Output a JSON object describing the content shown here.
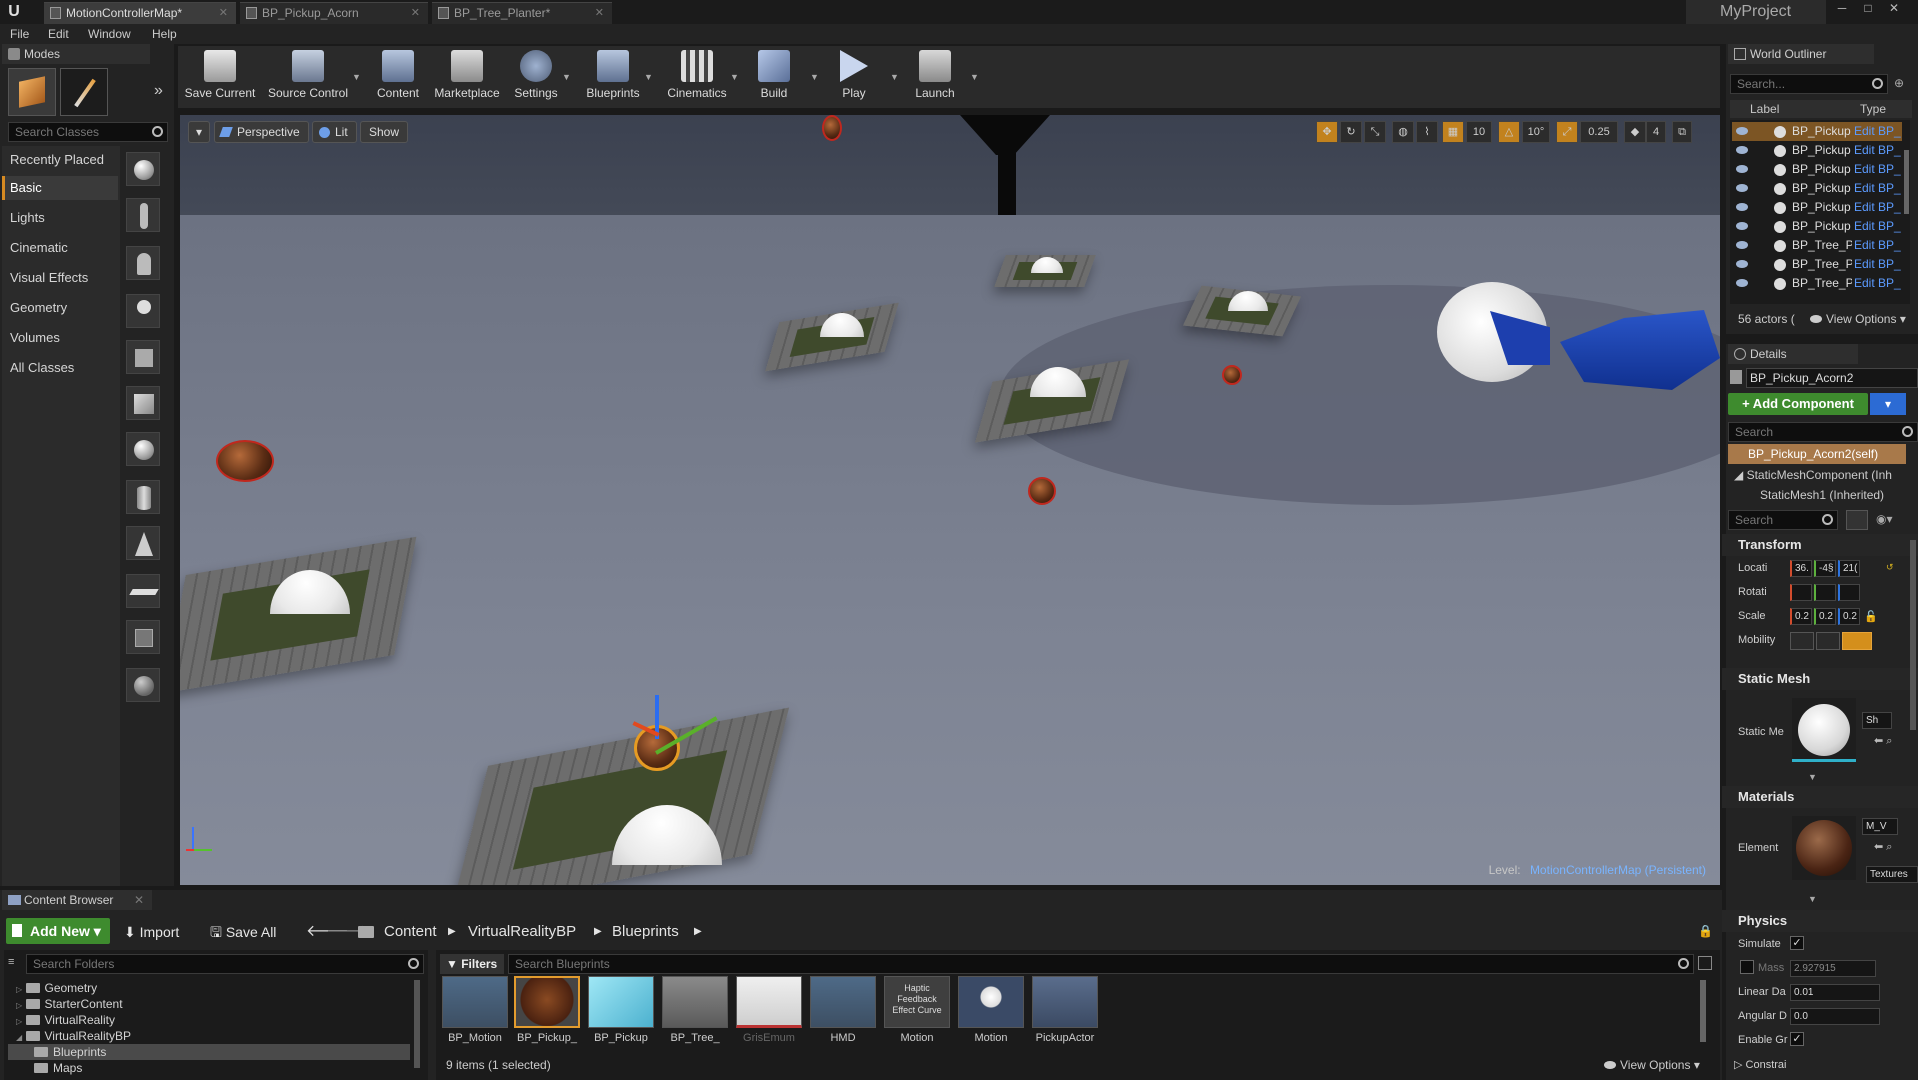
{
  "app": {
    "logo": "U",
    "project": "MyProject",
    "tabs": [
      {
        "label": "MotionControllerMap*",
        "active": true
      },
      {
        "label": "BP_Pickup_Acorn",
        "active": false
      },
      {
        "label": "BP_Tree_Planter*",
        "active": false
      }
    ],
    "window_buttons": [
      "─",
      "□",
      "✕"
    ]
  },
  "menu": [
    "File",
    "Edit",
    "Window",
    "Help"
  ],
  "modes": {
    "title": "Modes",
    "search_placeholder": "Search Classes",
    "categories": [
      "Recently Placed",
      "Basic",
      "Lights",
      "Cinematic",
      "Visual Effects",
      "Geometry",
      "Volumes",
      "All Classes"
    ],
    "selected": "Basic"
  },
  "toolbar": {
    "buttons": [
      "Save Current",
      "Source Control",
      "Content",
      "Marketplace",
      "Settings",
      "Blueprints",
      "Cinematics",
      "Build",
      "Play",
      "Launch"
    ]
  },
  "viewport": {
    "perspective": "Perspective",
    "lit": "Lit",
    "show": "Show",
    "snap_values": [
      "10",
      "10°",
      "0.25",
      "4"
    ],
    "level_label": "Level:",
    "level_name": "MotionControllerMap (Persistent)"
  },
  "outliner": {
    "title": "World Outliner",
    "search_placeholder": "Search...",
    "col_label": "Label",
    "col_type": "Type",
    "rows": [
      {
        "name": "BP_Pickup",
        "type": "Edit BP_",
        "selected": true
      },
      {
        "name": "BP_Pickup",
        "type": "Edit BP_",
        "selected": false
      },
      {
        "name": "BP_Pickup",
        "type": "Edit BP_",
        "selected": false
      },
      {
        "name": "BP_Pickup",
        "type": "Edit BP_",
        "selected": false
      },
      {
        "name": "BP_Pickup",
        "type": "Edit BP_",
        "selected": false
      },
      {
        "name": "BP_Pickup",
        "type": "Edit BP_",
        "selected": false
      },
      {
        "name": "BP_Tree_P",
        "type": "Edit BP_",
        "selected": false
      },
      {
        "name": "BP_Tree_P",
        "type": "Edit BP_",
        "selected": false
      },
      {
        "name": "BP_Tree_P",
        "type": "Edit BP_",
        "selected": false
      }
    ],
    "actor_count": "56 actors (",
    "view_options": "View Options"
  },
  "details": {
    "title": "Details",
    "actor_name": "BP_Pickup_Acorn2",
    "add_component": "+ Add Component",
    "search_placeholder": "Search",
    "self_label": "BP_Pickup_Acorn2(self)",
    "component": "StaticMeshComponent (Inh",
    "sub_component": "StaticMesh1 (Inherited)",
    "search2_placeholder": "Search",
    "transform_title": "Transform",
    "location_label": "Locati",
    "location": [
      "36.",
      "-4§",
      "21("
    ],
    "rotation_label": "Rotati",
    "scale_label": "Scale",
    "scale": [
      "0.2",
      "0.2",
      "0.2"
    ],
    "mobility_label": "Mobility",
    "static_mesh_title": "Static Mesh",
    "static_mesh_label": "Static Me",
    "static_mesh_dropdown": "Sh",
    "materials_title": "Materials",
    "element_label": "Element",
    "material_dropdown": "M_V",
    "textures_label": "Textures",
    "physics_title": "Physics",
    "simulate_label": "Simulate",
    "mass_label": "Mass",
    "mass_value": "2.927915",
    "linear_label": "Linear Da",
    "linear_value": "0.01",
    "angular_label": "Angular D",
    "angular_value": "0.0",
    "enable_label": "Enable Gr",
    "constraints_label": "Constrai"
  },
  "content_browser": {
    "title": "Content Browser",
    "add_new": "Add New",
    "import": "Import",
    "save_all": "Save All",
    "path": [
      "Content",
      "VirtualRealityBP",
      "Blueprints"
    ],
    "folder_search_placeholder": "Search Folders",
    "filters": "Filters",
    "asset_search_placeholder": "Search Blueprints",
    "tree": [
      {
        "name": "Geometry",
        "indent": 0
      },
      {
        "name": "StarterContent",
        "indent": 0
      },
      {
        "name": "VirtualReality",
        "indent": 0
      },
      {
        "name": "VirtualRealityBP",
        "indent": 0
      },
      {
        "name": "Blueprints",
        "indent": 1
      },
      {
        "name": "Maps",
        "indent": 1
      }
    ],
    "assets": [
      "BP_Motion",
      "BP_Pickup_",
      "BP_Pickup",
      "BP_Tree_",
      "GrisEmum",
      "HMD",
      "Motion",
      "Motion",
      "PickupActor"
    ],
    "haptic_text": "Haptic Feedback Effect Curve",
    "item_count": "9 items (1 selected)",
    "view_options": "View Options"
  },
  "colors": {
    "accent_orange": "#d68a22",
    "link_blue": "#5c9bff",
    "add_green": "#3e8b2e",
    "selection_orange": "#8a5a26"
  }
}
